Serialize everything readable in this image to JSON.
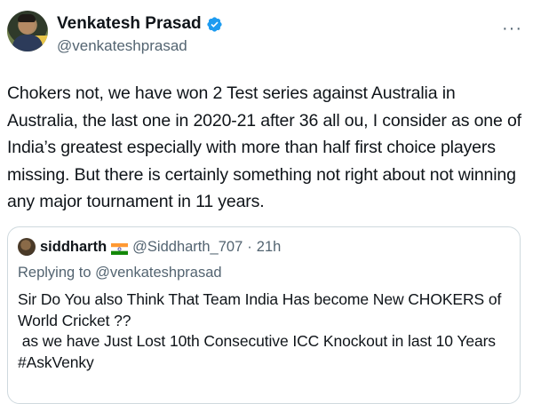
{
  "author": {
    "display_name": "Venkatesh Prasad",
    "handle": "@venkateshprasad",
    "avatar_icon": "profile-photo",
    "verified_icon": "verified-badge-icon",
    "verified_color": "#1d9bf0"
  },
  "more_icon": "more-horizontal-icon",
  "tweet_text": "Chokers not, we have won 2 Test series against Australia in Australia, the last one in 2020-21 after 36 all ou, I consider as one of India’s greatest especially with more than half first choice players missing. But there is certainly something not right about not winning any major tournament in 11 years.",
  "quoted": {
    "display_name": "siddharth",
    "flag_icon": "india-flag-icon",
    "handle": "@Siddharth_707",
    "separator": "·",
    "time": "21h",
    "replying_to": "Replying to @venkateshprasad",
    "text": "Sir Do You also Think That Team India Has become New CHOKERS of World Cricket ??\n as we have Just Lost 10th Consecutive ICC Knockout in last 10 Years\n#AskVenky"
  },
  "colors": {
    "text_primary": "#0f1419",
    "text_secondary": "#536471",
    "border": "#cfd9de"
  }
}
